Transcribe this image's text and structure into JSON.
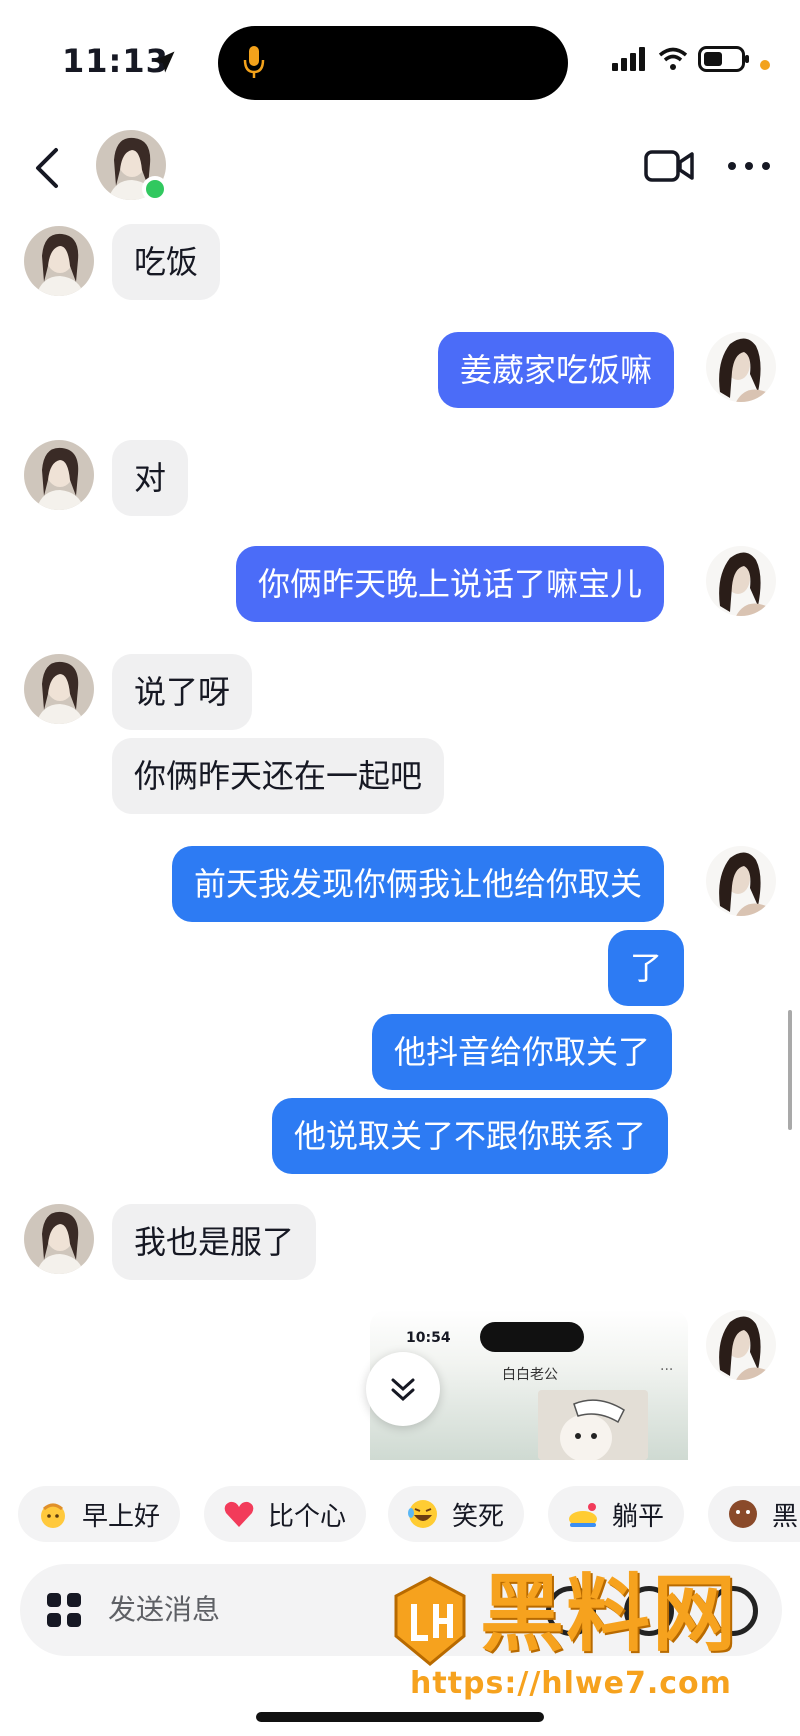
{
  "status_bar": {
    "time": "11:13"
  },
  "header": {
    "video_icon": "video-camera-icon",
    "more_icon": "more-dots-icon"
  },
  "messages": [
    {
      "side": "in",
      "text": "吃饭"
    },
    {
      "side": "out",
      "text": "姜葳家吃饭嘛"
    },
    {
      "side": "in",
      "text": "对"
    },
    {
      "side": "out",
      "text": "你俩昨天晚上说话了嘛宝儿"
    },
    {
      "side": "in",
      "text": "说了呀"
    },
    {
      "side": "in",
      "text": "你俩昨天还在一起吧"
    },
    {
      "side": "out",
      "text": "前天我发现你俩我让他给你取关"
    },
    {
      "side": "out",
      "text": "了"
    },
    {
      "side": "out",
      "text": "他抖音给你取关了"
    },
    {
      "side": "out",
      "text": "他说取关了不跟你联系了"
    },
    {
      "side": "in",
      "text": "我也是服了"
    }
  ],
  "preview": {
    "time": "10:54",
    "title": "白白老公",
    "dots": "···"
  },
  "quick_replies": [
    {
      "label": "早上好",
      "icon": "sun-emoji-icon"
    },
    {
      "label": "比个心",
      "icon": "heart-emoji-icon"
    },
    {
      "label": "笑死",
      "icon": "laugh-emoji-icon"
    },
    {
      "label": "躺平",
      "icon": "lying-flat-emoji-icon"
    },
    {
      "label": "黑",
      "icon": "black-emoji-icon"
    }
  ],
  "input": {
    "placeholder": "发送消息"
  },
  "watermark": {
    "brand": "黑料网",
    "url": "https://hlwe7.com"
  },
  "colors": {
    "outgoing_bubble": "#2d7bf3",
    "incoming_bubble": "#f0f0f1",
    "online": "#31c85f",
    "watermark": "#f6a21e"
  }
}
